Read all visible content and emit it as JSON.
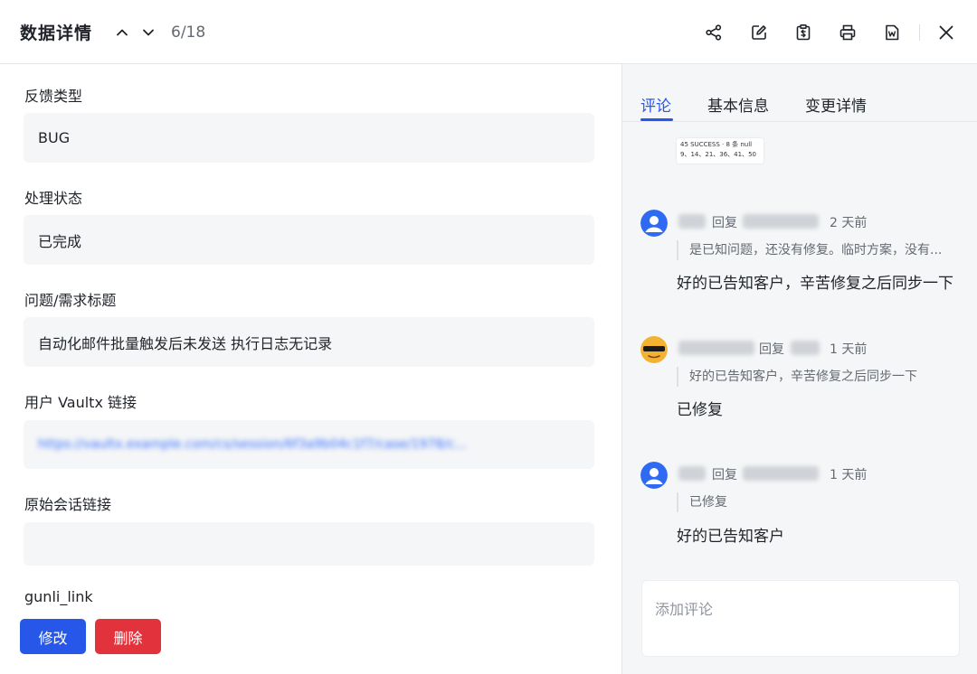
{
  "header": {
    "title": "数据详情",
    "counter": "6/18"
  },
  "form": {
    "fields": [
      {
        "label": "反馈类型",
        "value": "BUG"
      },
      {
        "label": "处理状态",
        "value": "已完成"
      },
      {
        "label": "问题/需求标题",
        "value": "自动化邮件批量触发后未发送 执行日志无记录"
      },
      {
        "label": "用户 Vaultx 链接",
        "value": "https://vaultx.example.com/cs/session/6f3a9b04c1f7/case/1978/c..."
      },
      {
        "label": "原始会话链接",
        "value": ""
      },
      {
        "label": "gunli_link",
        "value": ""
      }
    ]
  },
  "footer": {
    "edit_label": "修改",
    "delete_label": "删除"
  },
  "panel": {
    "tabs": [
      "评论",
      "基本信息",
      "变更详情"
    ],
    "active_tab": "评论",
    "thumbnail": {
      "line1": "45 SUCCESS · 8 条 null",
      "line2": "9、14、21、36、41、50"
    },
    "comments": [
      {
        "reply_word": "回复",
        "time": "2 天前",
        "quote": "是已知问题，还没有修复。临时方案，没有...",
        "text": "好的已告知客户，辛苦修复之后同步一下",
        "avatar": "user-avatar"
      },
      {
        "reply_word": "回复",
        "time": "1 天前",
        "quote": "好的已告知客户，辛苦修复之后同步一下",
        "text": "已修复",
        "avatar": "emoji-avatar"
      },
      {
        "reply_word": "回复",
        "time": "1 天前",
        "quote": "已修复",
        "text": "好的已告知客户",
        "avatar": "user-avatar"
      }
    ],
    "comment_placeholder": "添加评论"
  },
  "colors": {
    "accent": "#2757e8",
    "danger": "#e2323b"
  }
}
